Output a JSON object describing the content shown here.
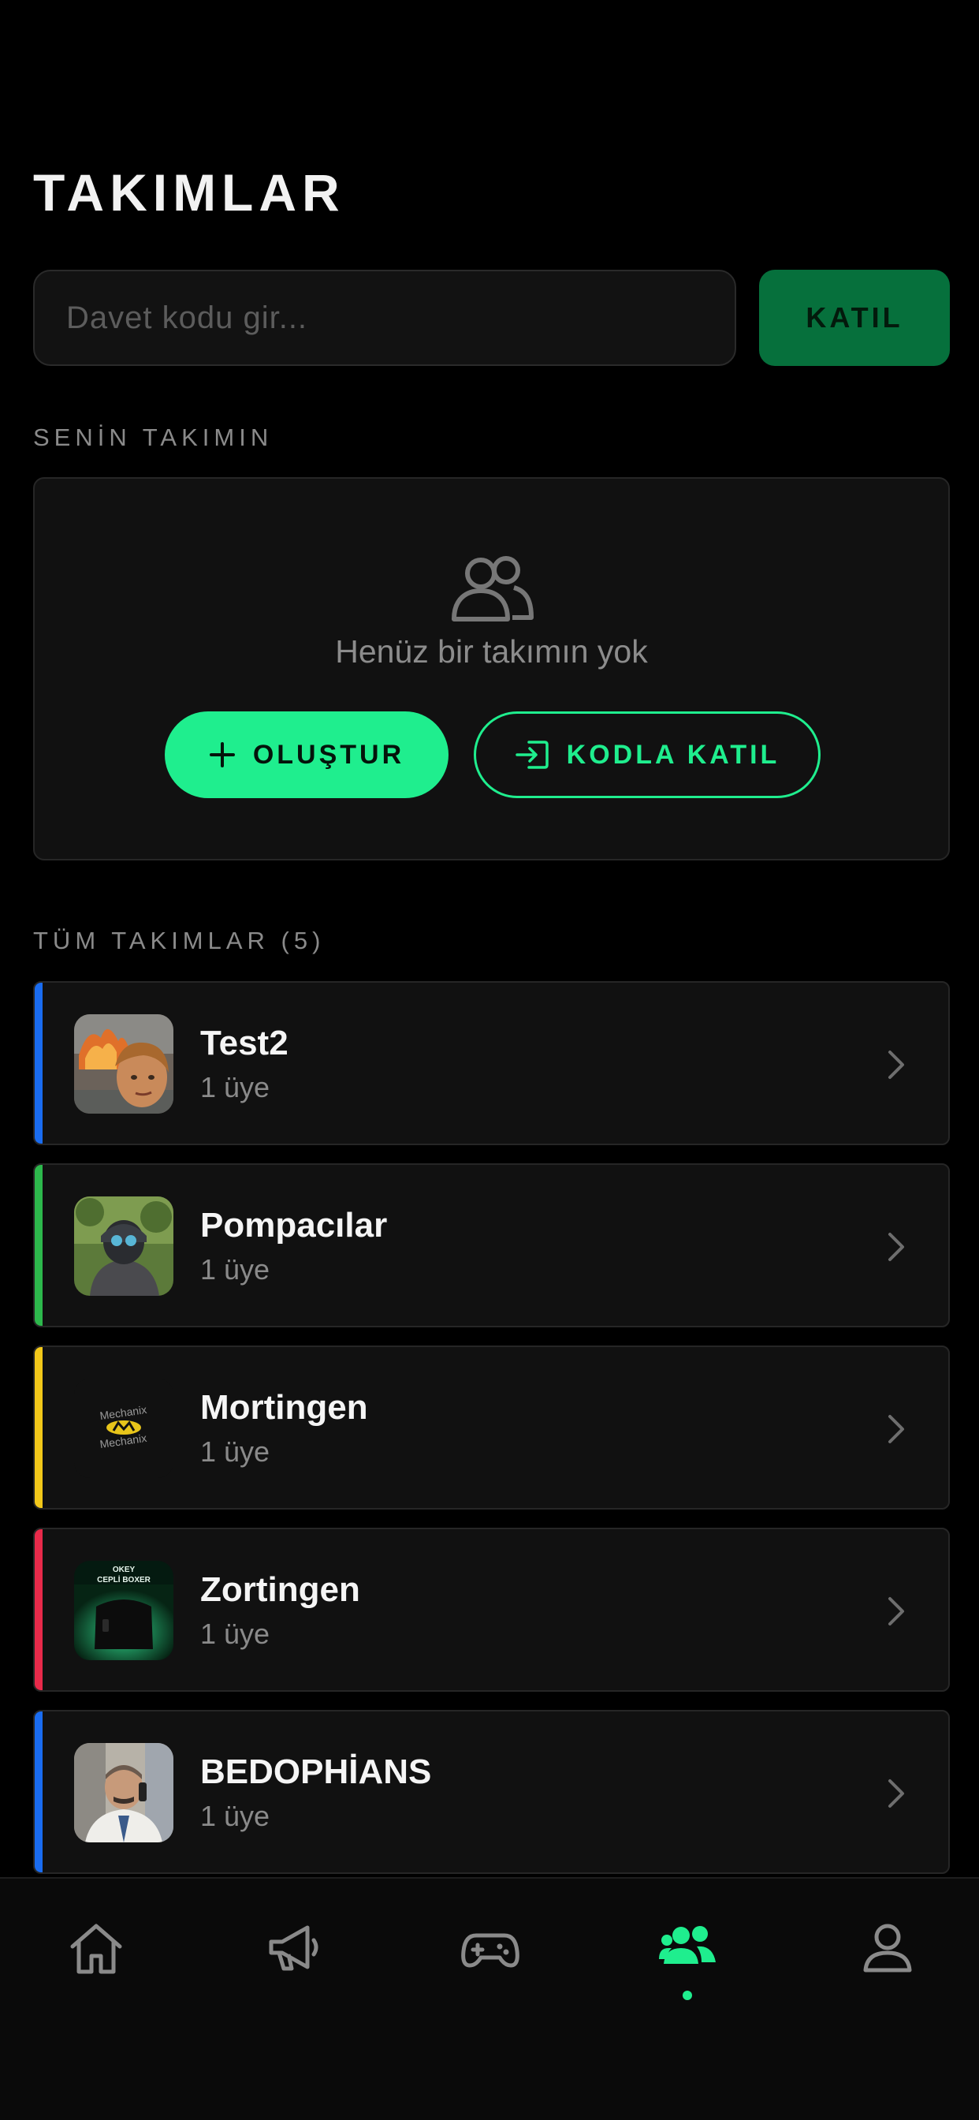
{
  "header": {
    "title": "TAKIMLAR"
  },
  "invite": {
    "placeholder": "Davet kodu gir...",
    "value": "",
    "join_label": "KATIL"
  },
  "my_team": {
    "section_label": "SENİN TAKIMIN",
    "empty_text": "Henüz bir takımın yok",
    "create_label": "OLUŞTUR",
    "code_join_label": "KODLA KATIL"
  },
  "all_teams": {
    "section_label": "TÜM TAKIMLAR (5)",
    "items": [
      {
        "name": "Test2",
        "members": "1 üye",
        "accent": "#1a6cf0"
      },
      {
        "name": "Pompacılar",
        "members": "1 üye",
        "accent": "#2db84c"
      },
      {
        "name": "Mortingen",
        "members": "1 üye",
        "accent": "#f2c81a"
      },
      {
        "name": "Zortingen",
        "members": "1 üye",
        "accent": "#e82a4a"
      },
      {
        "name": "BEDOPHİANS",
        "members": "1 üye",
        "accent": "#1a6cf0"
      }
    ]
  },
  "avatar_texts": {
    "mortingen_logo": "Mechanix",
    "zortingen_line1": "OKEY",
    "zortingen_line2": "CEPLİ BOXER"
  },
  "tabbar": {
    "tabs": [
      {
        "icon": "home-icon",
        "active": false
      },
      {
        "icon": "megaphone-icon",
        "active": false
      },
      {
        "icon": "gamepad-icon",
        "active": false
      },
      {
        "icon": "team-icon",
        "active": true
      },
      {
        "icon": "profile-icon",
        "active": false
      }
    ]
  },
  "colors": {
    "accent_green": "#1fee8e",
    "join_button_bg": "#06703c",
    "card_bg": "#111111",
    "page_bg": "#000000"
  }
}
